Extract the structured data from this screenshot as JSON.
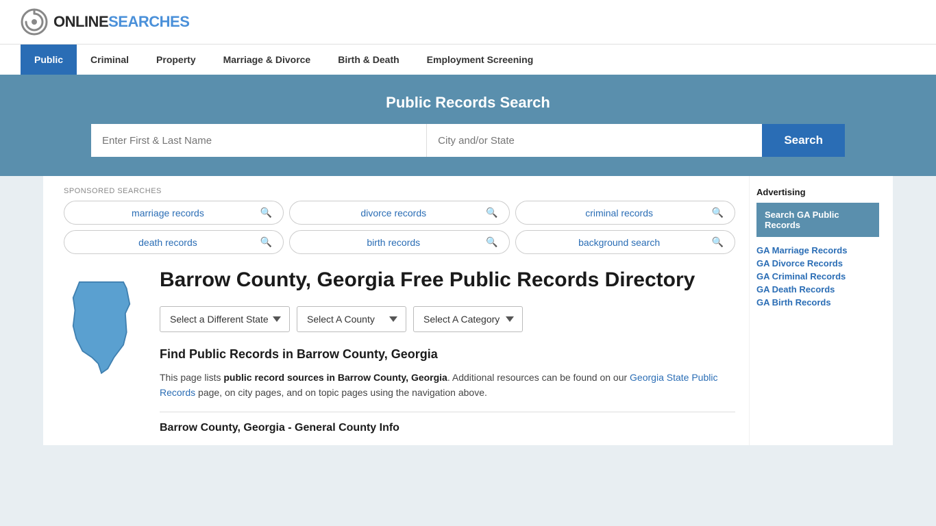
{
  "logo": {
    "online": "ONLINE",
    "searches": "SEARCHES"
  },
  "nav": {
    "items": [
      {
        "label": "Public",
        "active": true
      },
      {
        "label": "Criminal",
        "active": false
      },
      {
        "label": "Property",
        "active": false
      },
      {
        "label": "Marriage & Divorce",
        "active": false
      },
      {
        "label": "Birth & Death",
        "active": false
      },
      {
        "label": "Employment Screening",
        "active": false
      }
    ]
  },
  "search_banner": {
    "title": "Public Records Search",
    "name_placeholder": "Enter First & Last Name",
    "location_placeholder": "City and/or State",
    "search_button": "Search"
  },
  "sponsored": {
    "label": "SPONSORED SEARCHES",
    "tags": [
      {
        "text": "marriage records"
      },
      {
        "text": "divorce records"
      },
      {
        "text": "criminal records"
      },
      {
        "text": "death records"
      },
      {
        "text": "birth records"
      },
      {
        "text": "background search"
      }
    ]
  },
  "county": {
    "title": "Barrow County, Georgia Free Public Records Directory",
    "selects": {
      "state": "Select a Different State",
      "county": "Select A County",
      "category": "Select A Category"
    },
    "find_title": "Find Public Records in Barrow County, Georgia",
    "description_start": "This page lists ",
    "description_bold": "public record sources in Barrow County, Georgia",
    "description_mid": ". Additional resources can be found on our ",
    "description_link": "Georgia State Public Records",
    "description_end": " page, on city pages, and on topic pages using the navigation above.",
    "section_subtitle": "Barrow County, Georgia - General County Info"
  },
  "sidebar": {
    "ad_label": "Advertising",
    "banner_text": "Search GA Public Records",
    "links": [
      {
        "label": "GA Marriage Records"
      },
      {
        "label": "GA Divorce Records"
      },
      {
        "label": "GA Criminal Records"
      },
      {
        "label": "GA Death Records"
      },
      {
        "label": "GA Birth Records"
      }
    ]
  },
  "colors": {
    "accent_blue": "#2a6db5",
    "banner_blue": "#5a8fad",
    "nav_active": "#2a6db5",
    "georgia_map": "#4a90d9"
  }
}
